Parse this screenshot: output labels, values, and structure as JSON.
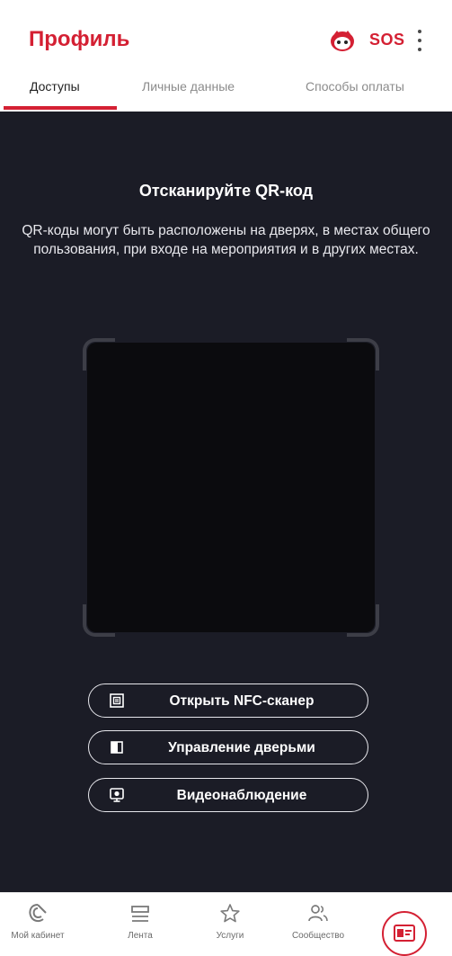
{
  "header": {
    "title": "Профиль",
    "sos": "SOS"
  },
  "tabs": [
    {
      "label": "Доступы",
      "active": true
    },
    {
      "label": "Личные данные",
      "active": false
    },
    {
      "label": "Способы оплаты",
      "active": false
    }
  ],
  "scanner": {
    "title": "Отсканируйте QR-код",
    "description": "QR-коды могут быть расположены на дверях, в местах общего пользования, при входе на мероприятия и в других местах."
  },
  "actions": [
    {
      "label": "Открыть NFC-сканер",
      "icon": "nfc-icon"
    },
    {
      "label": "Управление дверьми",
      "icon": "door-icon"
    },
    {
      "label": "Видеонаблюдение",
      "icon": "camera-icon"
    }
  ],
  "bottom_nav": [
    {
      "label": "Мой кабинет",
      "icon": "cabinet-icon"
    },
    {
      "label": "Лента",
      "icon": "feed-icon"
    },
    {
      "label": "Услуги",
      "icon": "star-icon"
    },
    {
      "label": "Сообщество",
      "icon": "community-icon"
    },
    {
      "label": "",
      "icon": "id-card-icon"
    }
  ],
  "colors": {
    "accent": "#d42033",
    "scanner_bg": "#1b1c26"
  }
}
